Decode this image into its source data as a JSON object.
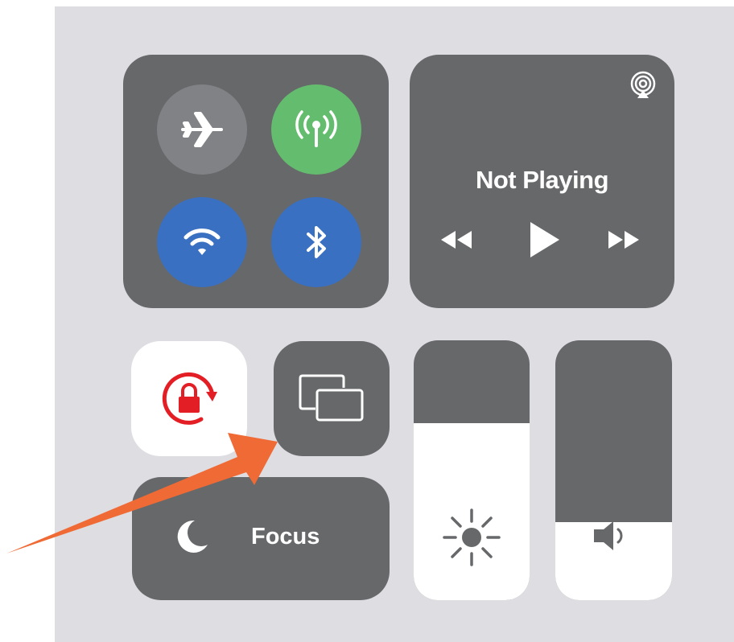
{
  "connectivity": {
    "airplane": {
      "icon": "airplane-icon",
      "color": "#808285"
    },
    "cellular": {
      "icon": "cellular-antenna-icon",
      "color": "#64bc6e"
    },
    "wifi": {
      "icon": "wifi-icon",
      "color": "#3a70c2"
    },
    "bluetooth": {
      "icon": "bluetooth-icon",
      "color": "#3a70c2"
    }
  },
  "now_playing": {
    "title": "Not Playing",
    "airplay_icon": "airplay-icon",
    "controls": [
      "rewind-icon",
      "play-icon",
      "fast-forward-icon"
    ]
  },
  "rotation_lock": {
    "icon": "rotation-lock-icon",
    "color": "#e31e24"
  },
  "screen_mirroring": {
    "icon": "screen-mirroring-icon"
  },
  "focus": {
    "label": "Focus",
    "icon": "moon-icon"
  },
  "brightness": {
    "icon": "sun-icon",
    "level_percent": 68
  },
  "volume": {
    "icon": "speaker-icon",
    "level_percent": 30
  },
  "annotation": {
    "color": "#f06a35"
  }
}
